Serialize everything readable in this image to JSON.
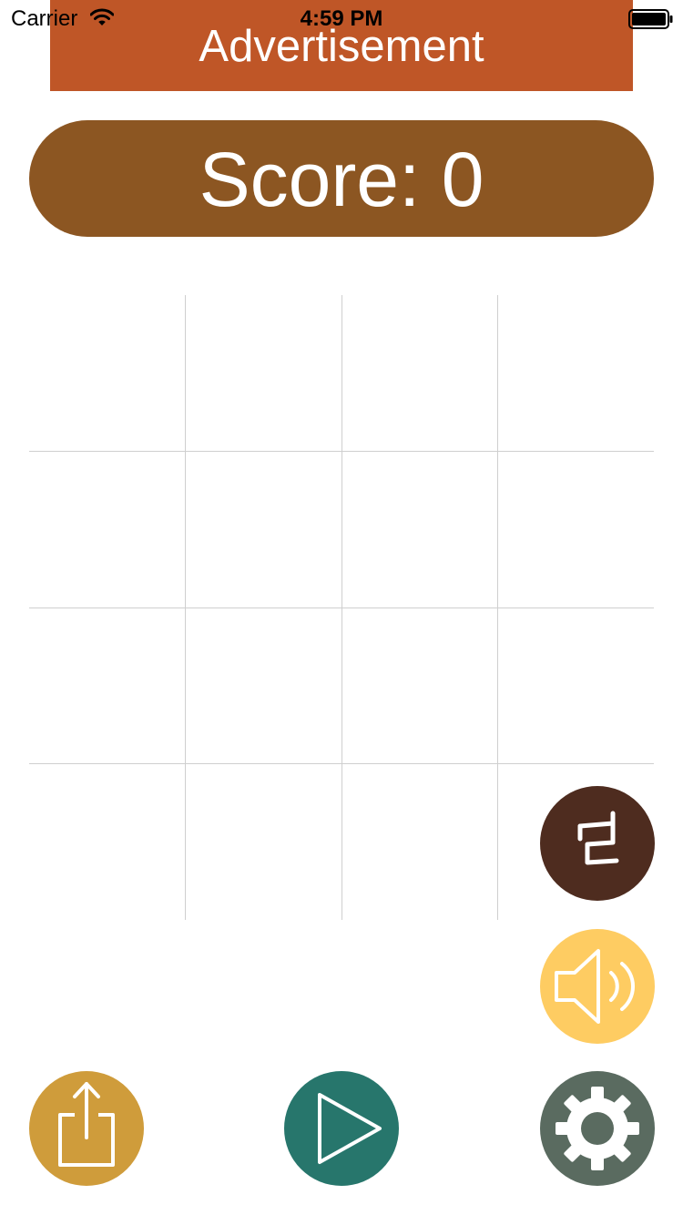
{
  "status_bar": {
    "carrier": "Carrier",
    "time": "4:59 PM",
    "wifi_icon": "wifi-icon",
    "battery_icon": "battery-full-icon"
  },
  "ad": {
    "label": "Advertisement",
    "color": "#bf5627"
  },
  "score": {
    "label": "Score:",
    "value": "0",
    "color": "#8c5622"
  },
  "board": {
    "rows": 4,
    "cols": 4,
    "line_color": "#cfcfcf",
    "cells": [
      "",
      "",
      "",
      "",
      "",
      "",
      "",
      "",
      "",
      "",
      "",
      "",
      "",
      "",
      "",
      ""
    ]
  },
  "buttons": {
    "language": {
      "glyph": "ㄹ",
      "icon": "language-icon",
      "color": "#4e2c1f"
    },
    "sound": {
      "icon": "speaker-icon",
      "color": "#fecc62"
    },
    "share": {
      "icon": "share-icon",
      "color": "#cf9c3b"
    },
    "play": {
      "icon": "play-icon",
      "color": "#27766c"
    },
    "settings": {
      "icon": "gear-icon",
      "color": "#5a6b60"
    }
  }
}
